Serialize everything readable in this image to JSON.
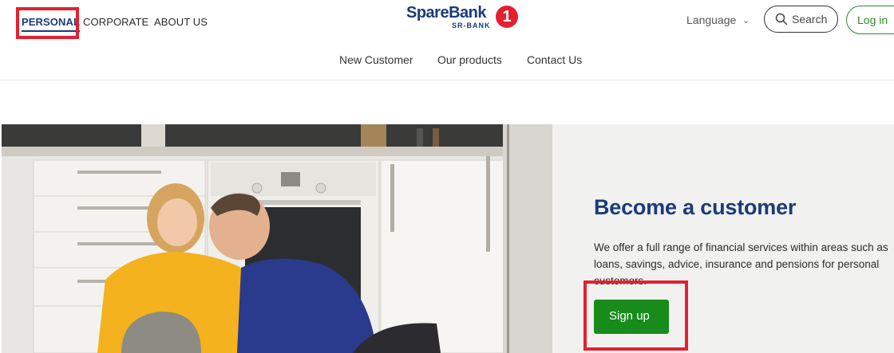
{
  "segments": {
    "personal": "PERSONAL",
    "corporate": "CORPORATE",
    "about": "ABOUT US"
  },
  "logo": {
    "name": "SpareBank",
    "sub": "SR-BANK",
    "mark": "1"
  },
  "header": {
    "language_label": "Language",
    "search_label": "Search",
    "login_label": "Log in"
  },
  "subnav": {
    "items": [
      "New Customer",
      "Our products",
      "Contact Us"
    ]
  },
  "hero": {
    "title": "Become a customer",
    "text": "We offer a full range of financial services within areas such as loans, savings, advice, insurance and pensions for personal customers.",
    "cta_label": "Sign up"
  },
  "colors": {
    "brand_blue": "#1a3b7a",
    "brand_red": "#e4202f",
    "cta_green": "#178c1a",
    "highlight_red": "#e4202f"
  },
  "icons": [
    "chevron-down-icon",
    "search-icon"
  ]
}
